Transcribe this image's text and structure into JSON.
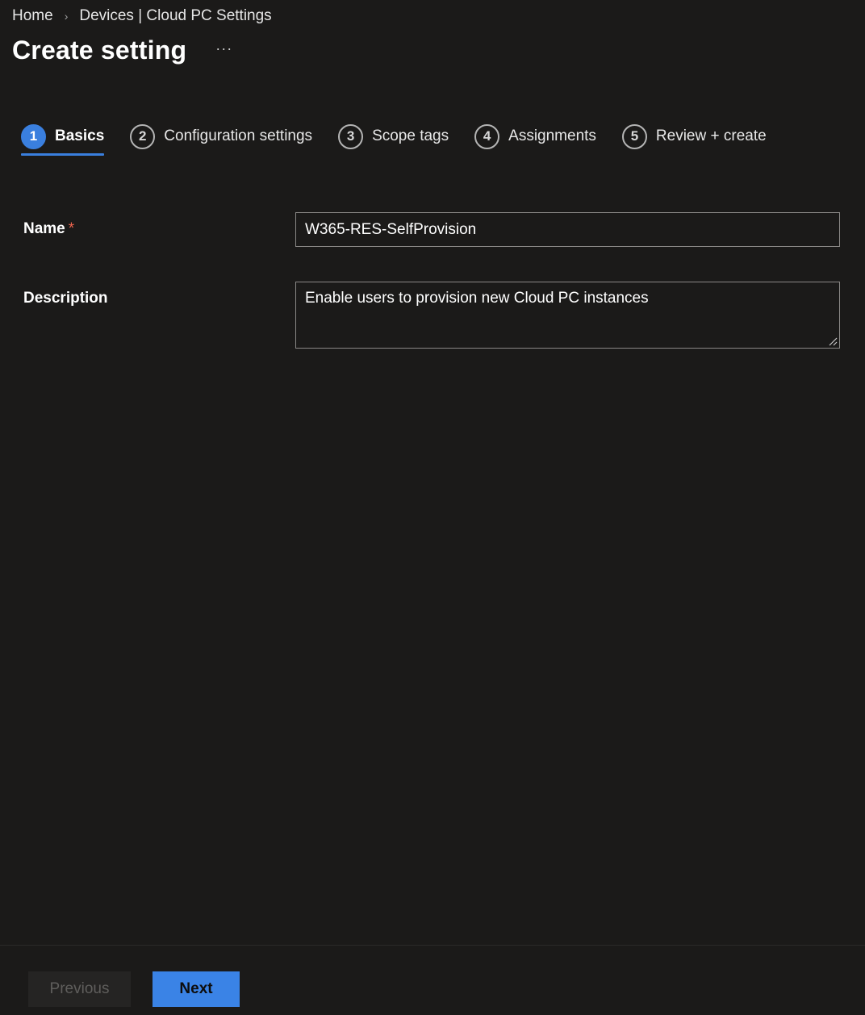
{
  "breadcrumb": {
    "items": [
      "Home",
      "Devices | Cloud PC Settings"
    ],
    "separator": "›"
  },
  "header": {
    "title": "Create setting",
    "more_label": "···"
  },
  "wizard": {
    "steps": [
      {
        "number": "1",
        "label": "Basics",
        "active": true
      },
      {
        "number": "2",
        "label": "Configuration settings",
        "active": false
      },
      {
        "number": "3",
        "label": "Scope tags",
        "active": false
      },
      {
        "number": "4",
        "label": "Assignments",
        "active": false
      },
      {
        "number": "5",
        "label": "Review + create",
        "active": false
      }
    ]
  },
  "form": {
    "name_label": "Name",
    "required_marker": "*",
    "name_value": "W365-RES-SelfProvision",
    "description_label": "Description",
    "description_value": "Enable users to provision new Cloud PC instances"
  },
  "footer": {
    "previous_label": "Previous",
    "next_label": "Next"
  },
  "colors": {
    "background": "#1b1a19",
    "accent": "#3a7fde",
    "required": "#f0654e"
  }
}
